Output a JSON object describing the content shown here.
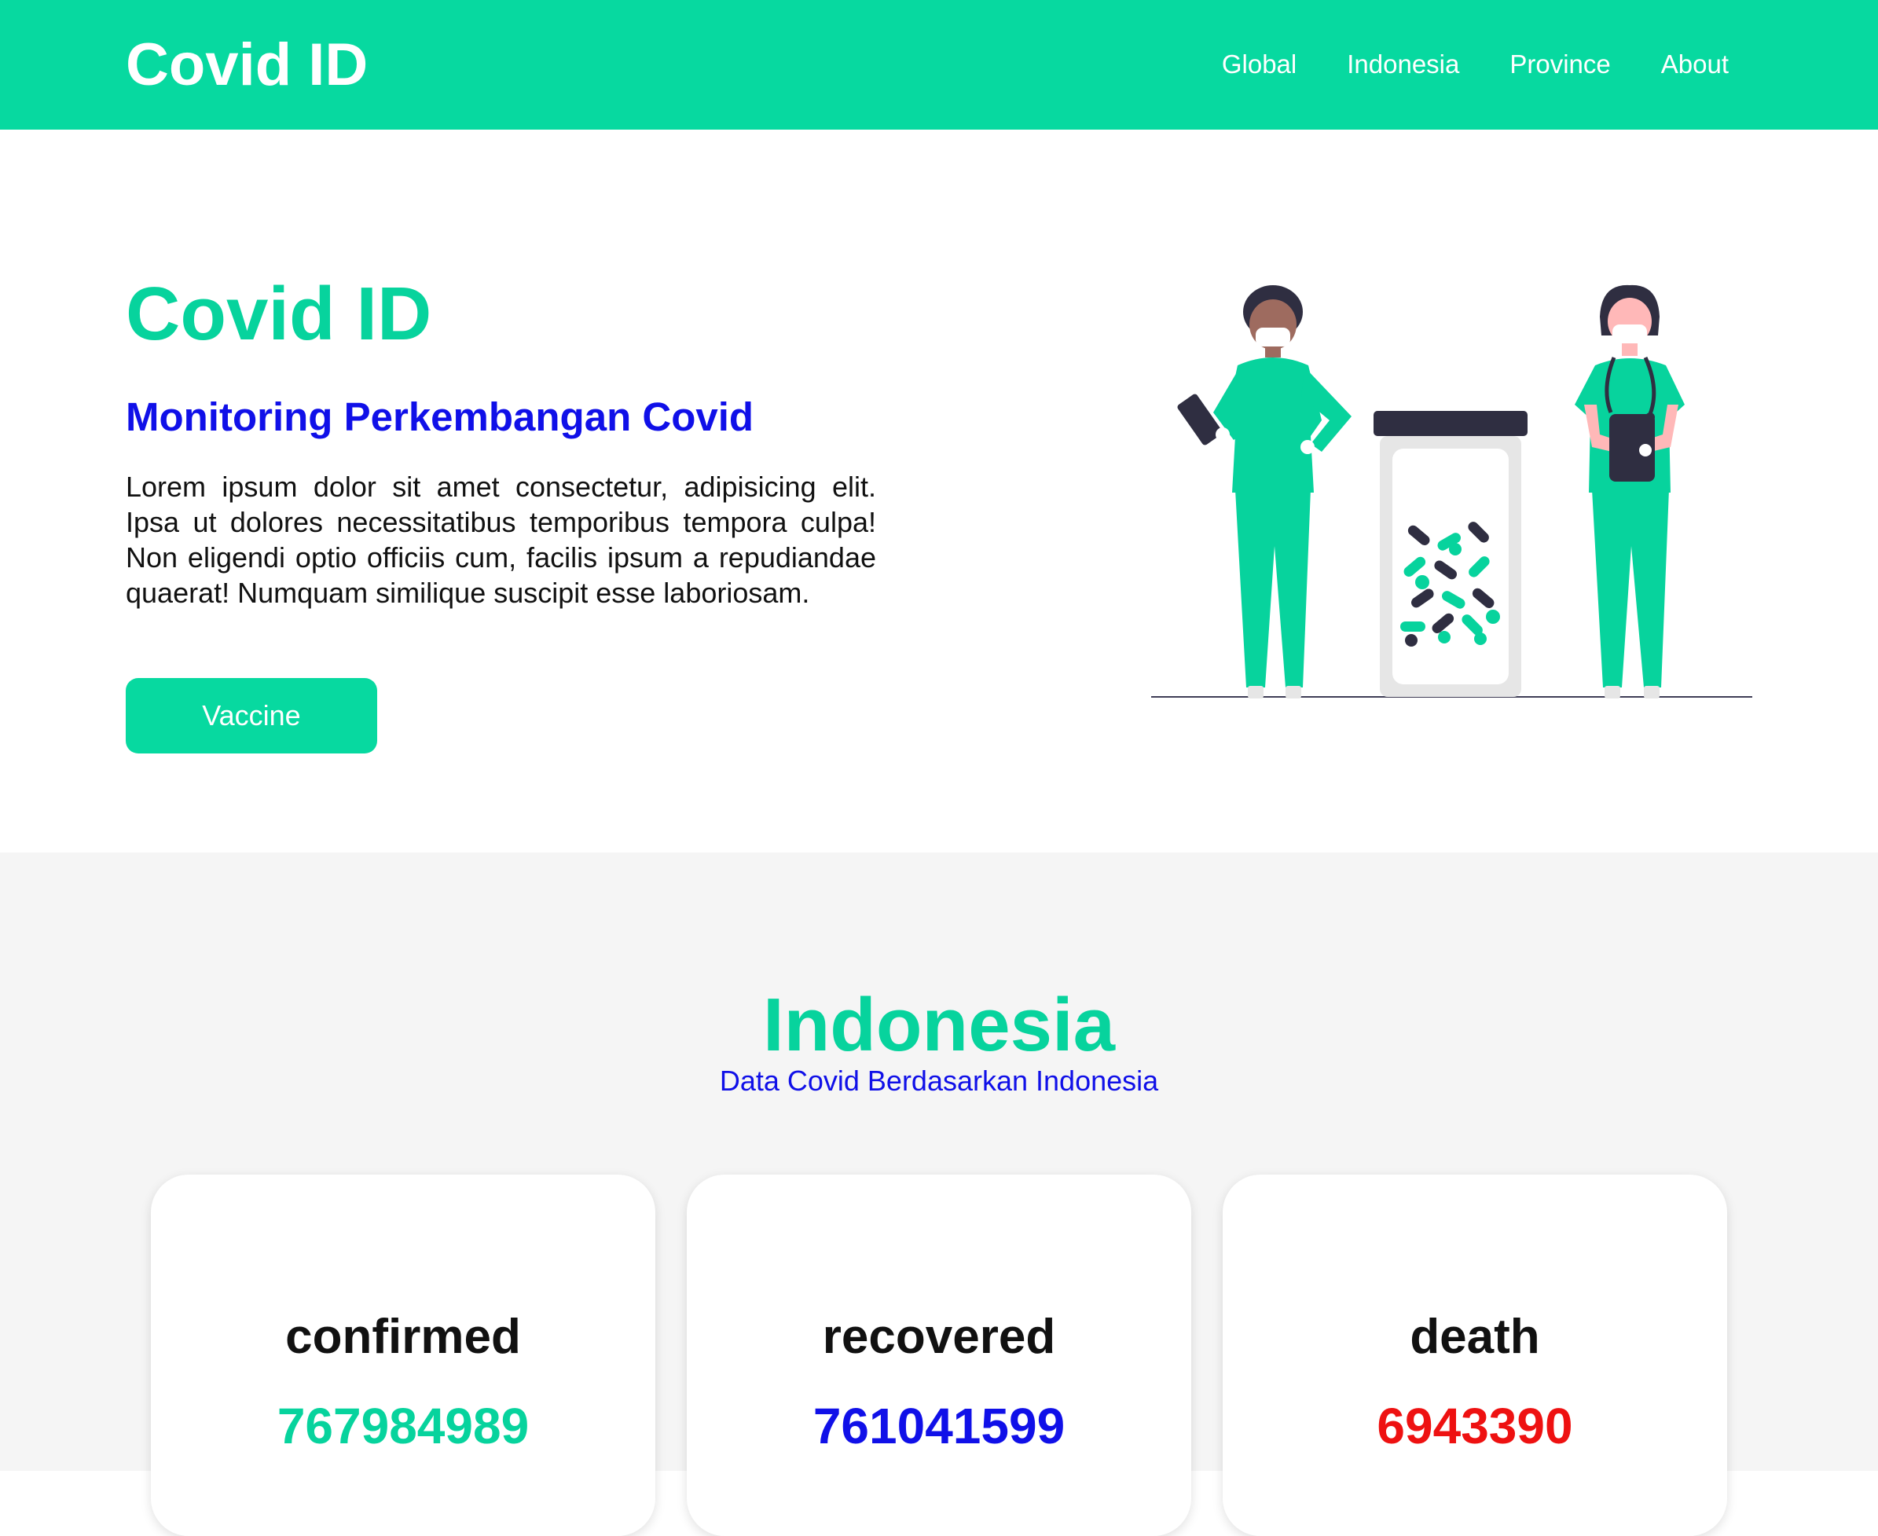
{
  "navbar": {
    "brand": "Covid ID",
    "links": [
      "Global",
      "Indonesia",
      "Province",
      "About"
    ]
  },
  "hero": {
    "title": "Covid ID",
    "subtitle": "Monitoring Perkembangan Covid",
    "text": "Lorem ipsum dolor sit amet consectetur, adipisicing elit. Ipsa ut dolores necessitatibus temporibus tempora culpa! Non eligendi optio officiis cum, facilis ipsum a repudiandae quaerat! Numquam similique suscipit esse laboriosam.",
    "button_label": "Vaccine",
    "illustration_icon": "doctors-medicine-illustration"
  },
  "stats": {
    "title": "Indonesia",
    "subtitle": "Data Covid Berdasarkan Indonesia",
    "cards": [
      {
        "label": "confirmed",
        "value": "767984989",
        "color": "#07d39d"
      },
      {
        "label": "recovered",
        "value": "761041599",
        "color": "#1010e8"
      },
      {
        "label": "death",
        "value": "6943390",
        "color": "#ee1111"
      }
    ]
  },
  "colors": {
    "accent": "#07d9a0",
    "blue": "#1010e8",
    "red": "#ee1111",
    "dark": "#2f2e41"
  }
}
